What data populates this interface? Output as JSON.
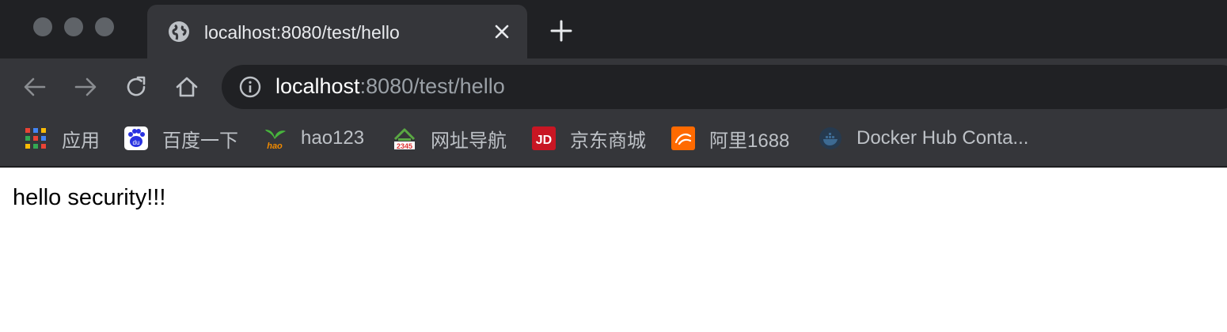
{
  "tab": {
    "title": "localhost:8080/test/hello"
  },
  "address_bar": {
    "host": "localhost",
    "path": ":8080/test/hello"
  },
  "bookmarks": [
    {
      "label": "应用",
      "icon": "apps-grid-icon"
    },
    {
      "label": "百度一下",
      "icon": "baidu-icon"
    },
    {
      "label": "hao123",
      "icon": "hao123-icon"
    },
    {
      "label": "网址导航",
      "icon": "2345-icon"
    },
    {
      "label": "京东商城",
      "icon": "jd-icon"
    },
    {
      "label": "阿里1688",
      "icon": "alibaba-1688-icon"
    },
    {
      "label": "Docker Hub Conta...",
      "icon": "docker-icon"
    }
  ],
  "page": {
    "body_text": "hello security!!!"
  },
  "colors": {
    "titlebar": "#202124",
    "toolbar": "#35363a",
    "omnibox": "#202124",
    "url_host": "#ffffff",
    "url_path": "#9aa0a6"
  }
}
